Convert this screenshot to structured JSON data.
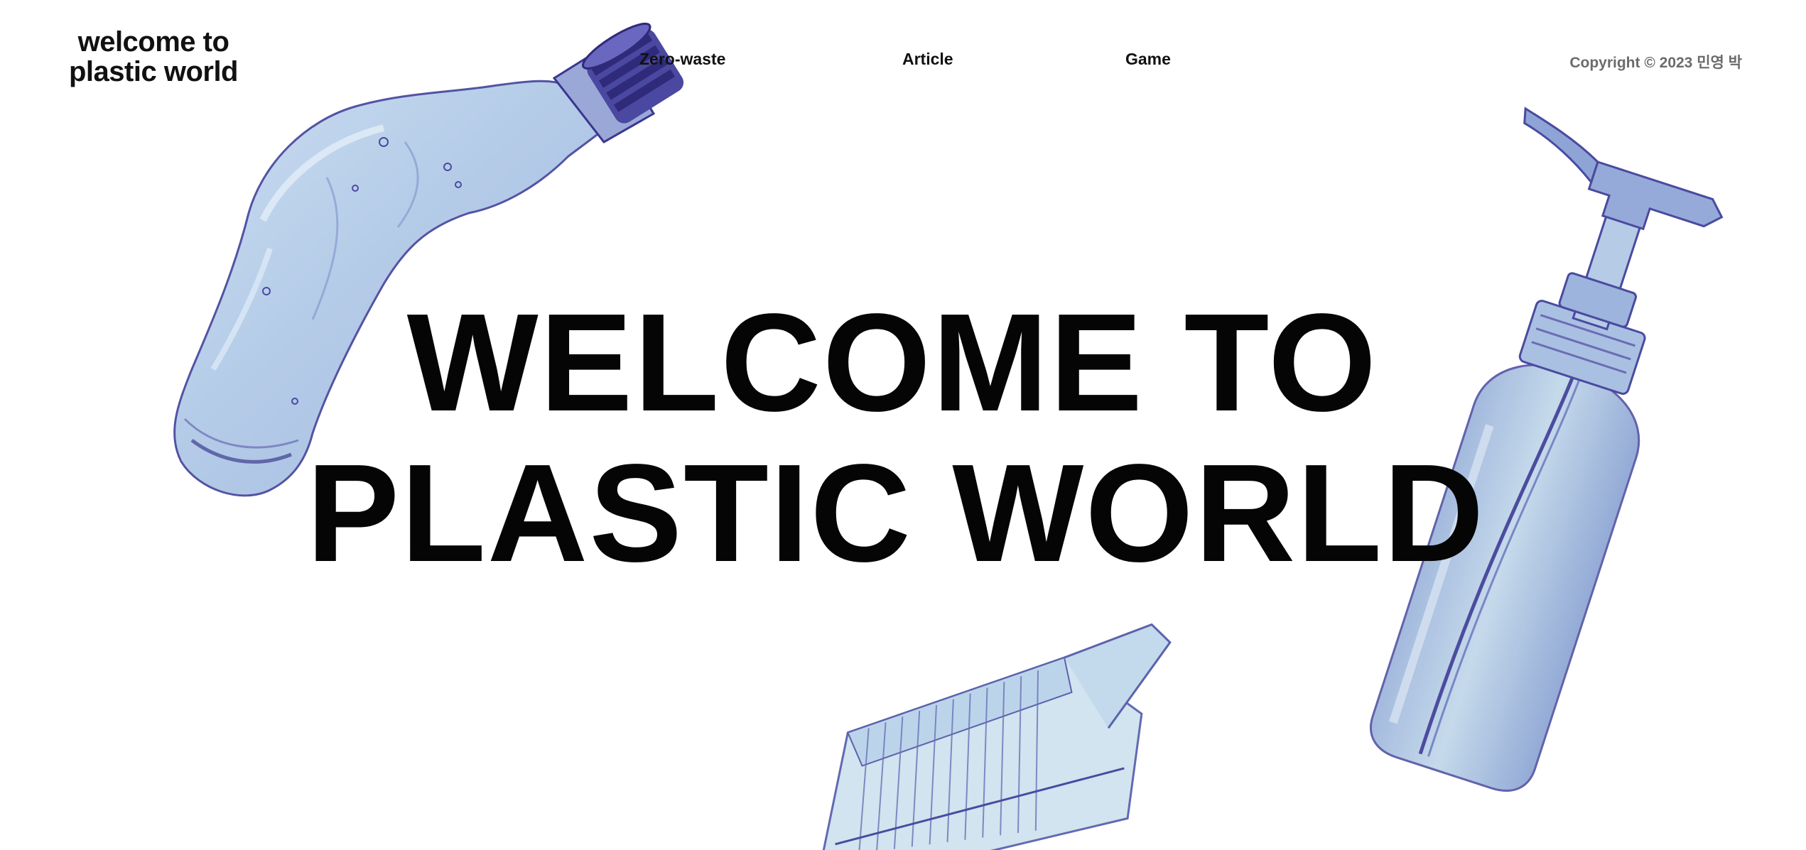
{
  "header": {
    "logo_line1": "welcome to",
    "logo_line2": "plastic world",
    "nav": {
      "zero_waste": "Zero-waste",
      "article": "Article",
      "game": "Game"
    },
    "copyright": "Copyright © 2023 민영 박"
  },
  "hero": {
    "line1": "WELCOME TO",
    "line2": "PLASTIC WORLD"
  },
  "art": {
    "bottle_fill": "#b9d2ea",
    "bottle_edge": "#4a4aa0",
    "cap_color": "#3b3690",
    "pump_fill": "#a9c3e2",
    "container_fill": "#cfe3ef",
    "icons": [
      "crushed-bottle-image",
      "pump-bottle-image",
      "clamshell-container-image"
    ]
  },
  "colors": {
    "background": "#ffffff",
    "text": "#050505",
    "muted": "#6b6b6b"
  }
}
